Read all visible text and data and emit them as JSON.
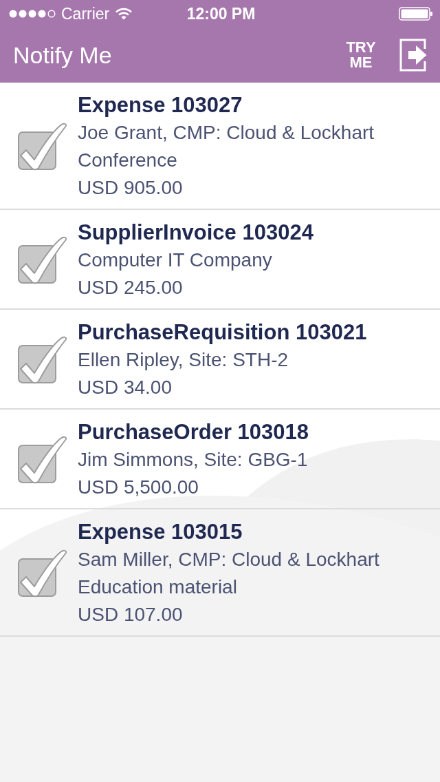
{
  "status_bar": {
    "carrier": "Carrier",
    "time": "12:00 PM"
  },
  "nav_bar": {
    "title": "Notify Me",
    "try_button": "TRY ME"
  },
  "items": [
    {
      "title": "Expense 103027",
      "lines": [
        "Joe Grant, CMP: Cloud & Lockhart",
        "Conference",
        "USD 905.00"
      ],
      "checked": true
    },
    {
      "title": "SupplierInvoice 103024",
      "lines": [
        "Computer IT Company",
        "USD 245.00"
      ],
      "checked": true
    },
    {
      "title": "PurchaseRequisition 103021",
      "lines": [
        "Ellen Ripley, Site: STH-2",
        "USD 34.00"
      ],
      "checked": true
    },
    {
      "title": "PurchaseOrder 103018",
      "lines": [
        "Jim Simmons, Site: GBG-1",
        "USD 5,500.00"
      ],
      "checked": true
    },
    {
      "title": "Expense 103015",
      "lines": [
        "Sam Miller, CMP: Cloud & Lockhart",
        "Education material",
        "USD 107.00"
      ],
      "checked": true
    }
  ]
}
